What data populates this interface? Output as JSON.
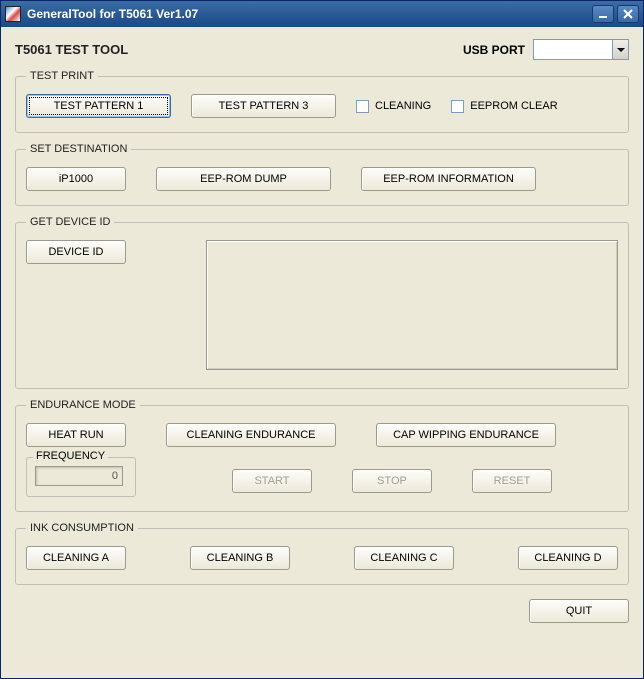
{
  "title": "GeneralTool for T5061 Ver1.07",
  "tool_title": "T5061 TEST TOOL",
  "usb_port": {
    "label": "USB PORT",
    "value": ""
  },
  "test_print": {
    "legend": "TEST PRINT",
    "pattern1": "TEST PATTERN 1",
    "pattern3": "TEST PATTERN 3",
    "cleaning": "CLEANING",
    "eeprom_clear": "EEPROM CLEAR"
  },
  "set_destination": {
    "legend": "SET DESTINATION",
    "ip1000": "iP1000",
    "dump": "EEP-ROM DUMP",
    "info": "EEP-ROM INFORMATION"
  },
  "get_device_id": {
    "legend": "GET DEVICE ID",
    "device_id": "DEVICE ID"
  },
  "endurance": {
    "legend": "ENDURANCE MODE",
    "heat_run": "HEAT RUN",
    "cleaning_end": "CLEANING ENDURANCE",
    "cap_wipping": "CAP WIPPING ENDURANCE",
    "frequency_label": "FREQUENCY",
    "frequency_value": "0",
    "start": "START",
    "stop": "STOP",
    "reset": "RESET"
  },
  "ink": {
    "legend": "INK CONSUMPTION",
    "a": "CLEANING A",
    "b": "CLEANING B",
    "c": "CLEANING C",
    "d": "CLEANING D"
  },
  "quit": "QUIT"
}
